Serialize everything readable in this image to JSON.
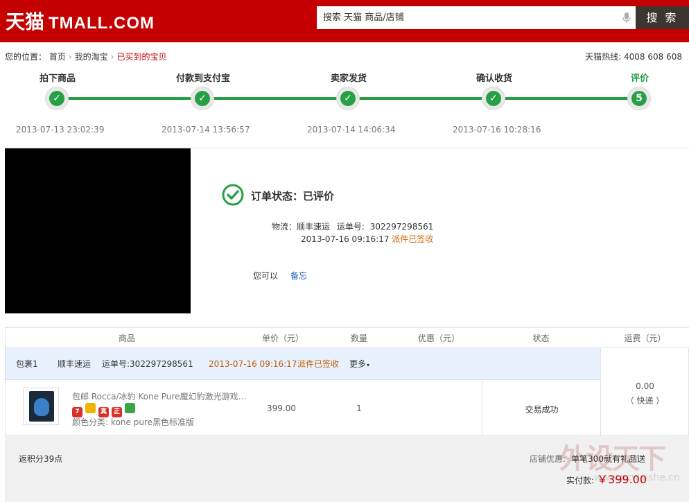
{
  "header": {
    "logo_cn": "天猫",
    "logo_en": "TMALL.COM",
    "search_placeholder": "搜索 天猫 商品/店铺",
    "search_button": "搜 索"
  },
  "breadcrumb": {
    "prefix": "您的位置：",
    "items": [
      "首页",
      "我的淘宝",
      "已买到的宝贝"
    ]
  },
  "hotline": "天猫热线: 4008 608 608",
  "steps": [
    {
      "label": "拍下商品",
      "time": "2013-07-13 23:02:39",
      "mark": "✓"
    },
    {
      "label": "付款到支付宝",
      "time": "2013-07-14 13:56:57",
      "mark": "✓"
    },
    {
      "label": "卖家发货",
      "time": "2013-07-14 14:06:34",
      "mark": "✓"
    },
    {
      "label": "确认收货",
      "time": "2013-07-16 10:28:16",
      "mark": "✓"
    },
    {
      "label": "评价",
      "time": "",
      "mark": "5"
    }
  ],
  "status": {
    "title": "订单状态：已评价",
    "logistics_label": "物流：",
    "carrier": "顺丰速运",
    "tracking_label": "运单号:",
    "tracking_no": "302297298561",
    "sign_time": "2013-07-16 09:16:17",
    "sign_status": "派件已签收",
    "you_can": "您可以",
    "memo_link": "备忘"
  },
  "table": {
    "headers": [
      "商品",
      "单价（元）",
      "数量",
      "优惠（元）",
      "状态",
      "运费（元）"
    ],
    "package": {
      "name": "包裹1",
      "carrier": "顺丰速运",
      "tracking": "运单号:302297298561",
      "time": "2013-07-16 09:16:17",
      "status": "派件已签收",
      "more": "更多"
    },
    "item": {
      "title": "包邮 Rocca/冰豹 Kone Pure魔幻豹激光游戏…",
      "sku_label": "颜色分类:",
      "sku_value": "kone pure黑色标准版",
      "price": "399.00",
      "qty": "1",
      "status": "交易成功"
    },
    "freight": {
      "amount": "0.00",
      "type": "（ 快递 ）"
    },
    "badges": [
      {
        "text": "7",
        "color": "#d9302a"
      },
      {
        "text": "",
        "color": "#f0b400"
      },
      {
        "text": "真",
        "color": "#d9302a"
      },
      {
        "text": "正",
        "color": "#d9302a"
      },
      {
        "text": "",
        "color": "#3aa545"
      }
    ]
  },
  "summary": {
    "points": "返积分39点",
    "shop_promo_label": "店铺优惠:",
    "shop_promo_value": "单笔300就有礼品送",
    "paid_label": "实付款:",
    "paid_amount": "￥399.00"
  },
  "watermark": {
    "main": "外设天下",
    "sub": "www.pcwaishe.cn"
  },
  "colors": {
    "brand_red": "#c40000",
    "progress_green": "#27a045",
    "package_bg": "#e8f2ff",
    "link_blue": "#1f5ea8",
    "orange": "#cc6600"
  }
}
